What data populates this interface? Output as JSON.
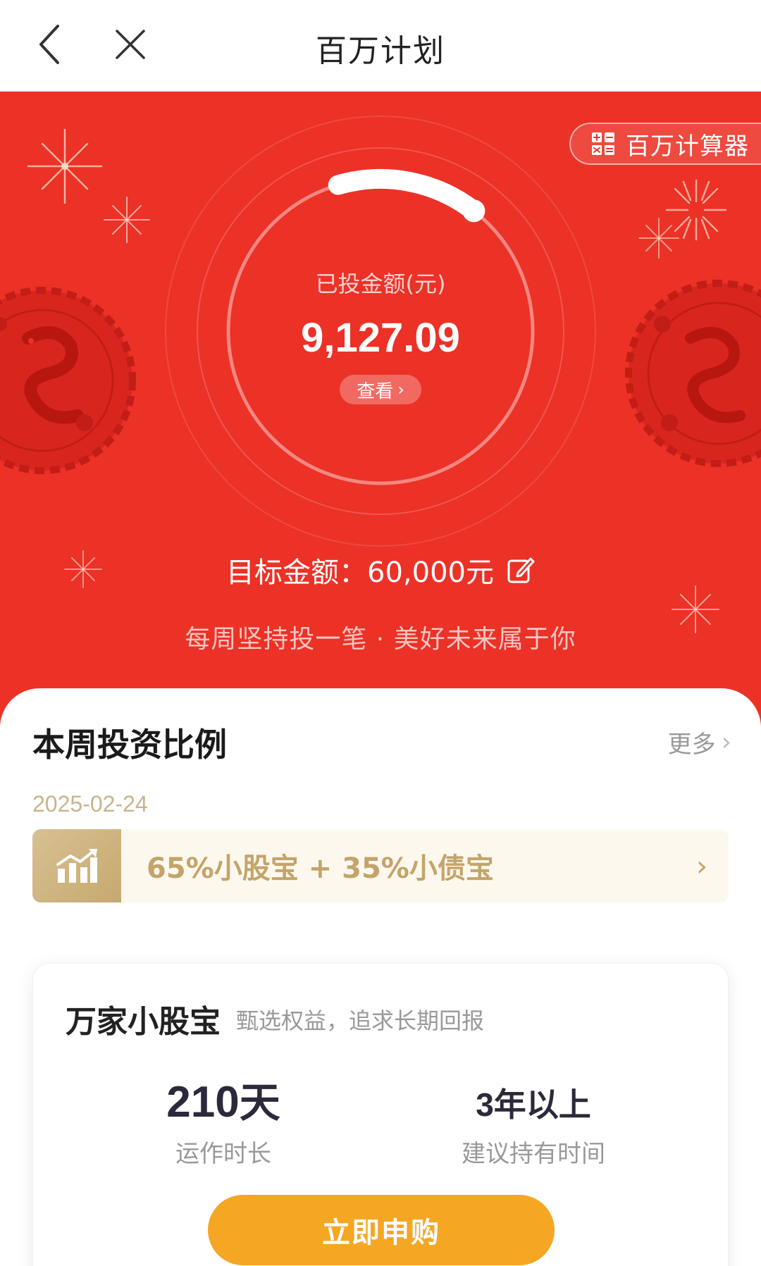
{
  "header": {
    "title": "百万计划",
    "back_icon": "chevron-left-icon",
    "close_icon": "close-icon"
  },
  "hero": {
    "background_color": "#ec3126",
    "calculator_label": "百万计算器",
    "invested_label": "已投金额(元)",
    "invested_value": "9,127.09",
    "view_label": "查看",
    "progress_fraction": 0.15,
    "target_text": "目标金额：60,000元",
    "slogan": "每周坚持投一笔 · 美好未来属于你"
  },
  "weekly_ratio": {
    "title": "本周投资比例",
    "more_label": "更多",
    "date": "2025-02-24",
    "ratio_text": "65%小股宝 + 35%小债宝"
  },
  "fund": {
    "name": "万家小股宝",
    "description": "甄选权益，追求长期回报",
    "stat1_value": "210",
    "stat1_unit": "天",
    "stat1_label": "运作时长",
    "stat2_value": "3年以上",
    "stat2_label": "建议持有时间",
    "buy_label": "立即申购",
    "buy_color": "#f5a623"
  }
}
